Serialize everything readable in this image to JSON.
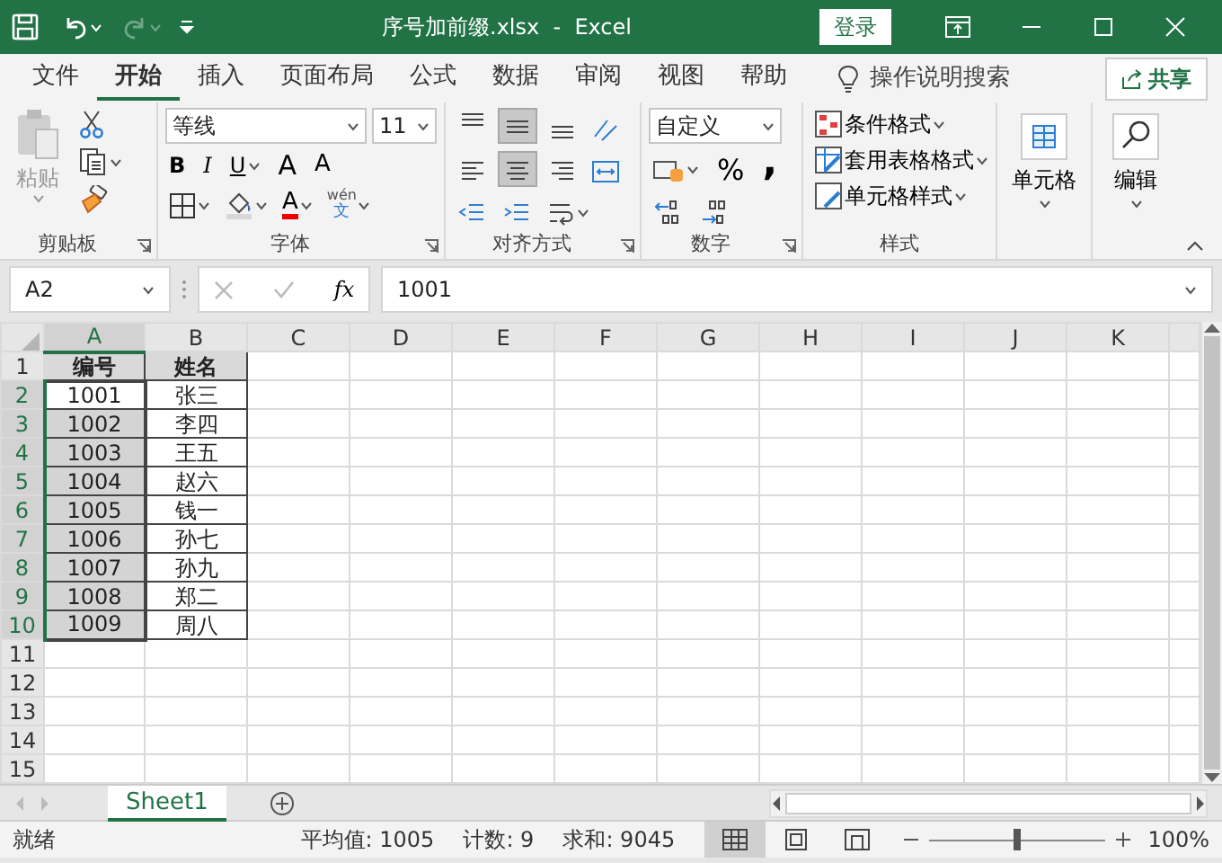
{
  "title_bar": {
    "title": "序号加前缀.xlsx  -  Excel",
    "sign_in": "登录"
  },
  "menu_tabs": [
    {
      "label": "文件",
      "selected": false
    },
    {
      "label": "开始",
      "selected": true
    },
    {
      "label": "插入",
      "selected": false
    },
    {
      "label": "页面布局",
      "selected": false
    },
    {
      "label": "公式",
      "selected": false
    },
    {
      "label": "数据",
      "selected": false
    },
    {
      "label": "审阅",
      "selected": false
    },
    {
      "label": "视图",
      "selected": false
    },
    {
      "label": "帮助",
      "selected": false
    }
  ],
  "tell_me": "操作说明搜索",
  "share": "共享",
  "ribbon": {
    "clipboard": {
      "paste": "粘贴",
      "label": "剪贴板"
    },
    "font": {
      "font_name": "等线",
      "font_size": "11",
      "bold": "B",
      "italic": "I",
      "underline": "U",
      "grow": "A",
      "shrink": "A",
      "font_color": "A",
      "phonetic_top": "wén",
      "phonetic_bottom": "文",
      "label": "字体"
    },
    "alignment": {
      "buttons": [
        {
          "kind": "top",
          "selected": false
        },
        {
          "kind": "middle",
          "selected": true
        },
        {
          "kind": "bottom",
          "selected": false
        },
        {
          "kind": "left",
          "selected": false
        },
        {
          "kind": "center",
          "selected": true
        },
        {
          "kind": "right",
          "selected": false
        }
      ],
      "label": "对齐方式"
    },
    "number": {
      "format": "自定义",
      "percent": "%",
      "comma": ",",
      "label": "数字"
    },
    "styles": {
      "items": [
        "条件格式",
        "套用表格格式",
        "单元格样式"
      ],
      "label": "样式"
    },
    "cells": {
      "label": "单元格"
    },
    "editing": {
      "label": "编辑"
    }
  },
  "formula_bar": {
    "name_box": "A2",
    "fx": "fx",
    "value": "1001"
  },
  "grid": {
    "columns": [
      {
        "label": "A",
        "selected": true
      },
      {
        "label": "B",
        "selected": false
      },
      {
        "label": "C",
        "selected": false
      },
      {
        "label": "D",
        "selected": false
      },
      {
        "label": "E",
        "selected": false
      },
      {
        "label": "F",
        "selected": false
      },
      {
        "label": "G",
        "selected": false
      },
      {
        "label": "H",
        "selected": false
      },
      {
        "label": "I",
        "selected": false
      },
      {
        "label": "J",
        "selected": false
      },
      {
        "label": "K",
        "selected": false
      }
    ],
    "rows": [
      {
        "number": "1",
        "selected": false,
        "kind": "header",
        "cells": [
          {
            "text": "编号",
            "selected": false,
            "active": false
          },
          {
            "text": "姓名",
            "selected": false,
            "active": false
          }
        ]
      },
      {
        "number": "2",
        "selected": true,
        "kind": "data",
        "cells": [
          {
            "text": "1001",
            "selected": true,
            "active": true
          },
          {
            "text": "张三",
            "selected": false
          }
        ]
      },
      {
        "number": "3",
        "selected": true,
        "kind": "data",
        "cells": [
          {
            "text": "1002",
            "selected": true,
            "active": false
          },
          {
            "text": "李四",
            "selected": false
          }
        ]
      },
      {
        "number": "4",
        "selected": true,
        "kind": "data",
        "cells": [
          {
            "text": "1003",
            "selected": true,
            "active": false
          },
          {
            "text": "王五",
            "selected": false
          }
        ]
      },
      {
        "number": "5",
        "selected": true,
        "kind": "data",
        "cells": [
          {
            "text": "1004",
            "selected": true,
            "active": false
          },
          {
            "text": "赵六",
            "selected": false
          }
        ]
      },
      {
        "number": "6",
        "selected": true,
        "kind": "data",
        "cells": [
          {
            "text": "1005",
            "selected": true,
            "active": false
          },
          {
            "text": "钱一",
            "selected": false
          }
        ]
      },
      {
        "number": "7",
        "selected": true,
        "kind": "data",
        "cells": [
          {
            "text": "1006",
            "selected": true,
            "active": false
          },
          {
            "text": "孙七",
            "selected": false
          }
        ]
      },
      {
        "number": "8",
        "selected": true,
        "kind": "data",
        "cells": [
          {
            "text": "1007",
            "selected": true,
            "active": false
          },
          {
            "text": "孙九",
            "selected": false
          }
        ]
      },
      {
        "number": "9",
        "selected": true,
        "kind": "data",
        "cells": [
          {
            "text": "1008",
            "selected": true,
            "active": false
          },
          {
            "text": "郑二",
            "selected": false
          }
        ]
      },
      {
        "number": "10",
        "selected": true,
        "kind": "data",
        "cells": [
          {
            "text": "1009",
            "selected": true,
            "active": false
          },
          {
            "text": "周八",
            "selected": false
          }
        ]
      },
      {
        "number": "11",
        "selected": false,
        "kind": "empty",
        "cells": []
      },
      {
        "number": "12",
        "selected": false,
        "kind": "empty",
        "cells": []
      },
      {
        "number": "13",
        "selected": false,
        "kind": "empty",
        "cells": []
      },
      {
        "number": "14",
        "selected": false,
        "kind": "empty",
        "cells": []
      },
      {
        "number": "15",
        "selected": false,
        "kind": "empty",
        "cells": []
      }
    ]
  },
  "sheet_tabs": [
    {
      "label": "Sheet1",
      "selected": true
    }
  ],
  "status_bar": {
    "status": "就绪",
    "stats": [
      "平均值: 1005",
      "计数: 9",
      "求和: 9045"
    ],
    "views": [
      {
        "kind": "normal",
        "selected": true
      },
      {
        "kind": "page_layout",
        "selected": false
      },
      {
        "kind": "page_break",
        "selected": false
      }
    ],
    "zoom": {
      "level": 0.5,
      "label": "100%"
    }
  }
}
